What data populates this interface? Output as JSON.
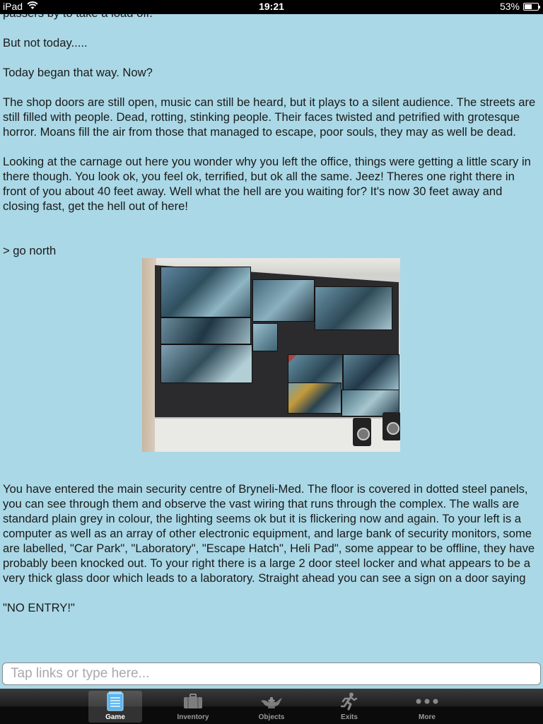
{
  "status": {
    "device": "iPad",
    "time": "19:21",
    "battery": "53%",
    "battery_level": 0.53
  },
  "story": {
    "cut_line": "passers by to take a load off.",
    "p1": "But not today.....",
    "p2": "Today began that way. Now?",
    "p3": "The shop doors are still open, music can still be heard, but it plays to a silent audience. The streets are still filled with people. Dead, rotting, stinking people. Their faces twisted and petrified with grotesque horror. Moans fill the air from those that managed to escape, poor souls, they may as well be dead.",
    "p4": "Looking at the carnage out here you wonder why you left the office, things were getting a little scary in there though. You look ok, you feel ok, terrified, but ok all the same. Jeez! Theres one right there in front of you about 40 feet away. Well what the hell are you waiting for? It's now 30 feet away and closing fast, get the hell out of here!",
    "command": "> go north",
    "p5": "You have entered the main security centre of Bryneli-Med. The floor is covered in dotted steel panels, you can see through them and observe the vast wiring that runs through the complex. The walls are standard plain grey in colour, the lighting seems ok but it is flickering now and again. To your left is a computer as well as an array of other electronic equipment, and large bank of security monitors, some are labelled, \"Car Park\", \"Laboratory\", \"Escape Hatch\", Heli Pad\", some appear to be offline, they have probably been knocked out. To your right there is a large 2 door steel locker and what appears to be a very thick glass door which leads to a laboratory. Straight ahead you can see a sign on a door saying",
    "p6": "\"NO ENTRY!\""
  },
  "input": {
    "placeholder": "Tap links or type here..."
  },
  "tabs": [
    {
      "label": "Game",
      "icon": "notepad-icon",
      "active": true
    },
    {
      "label": "Inventory",
      "icon": "briefcase-icon",
      "active": false
    },
    {
      "label": "Objects",
      "icon": "lamp-icon",
      "active": false
    },
    {
      "label": "Exits",
      "icon": "running-man-icon",
      "active": false
    },
    {
      "label": "More",
      "icon": "more-dots-icon",
      "active": false
    }
  ],
  "colors": {
    "background": "#aad8e6",
    "active_tab_icon": "#4aa8e8"
  }
}
